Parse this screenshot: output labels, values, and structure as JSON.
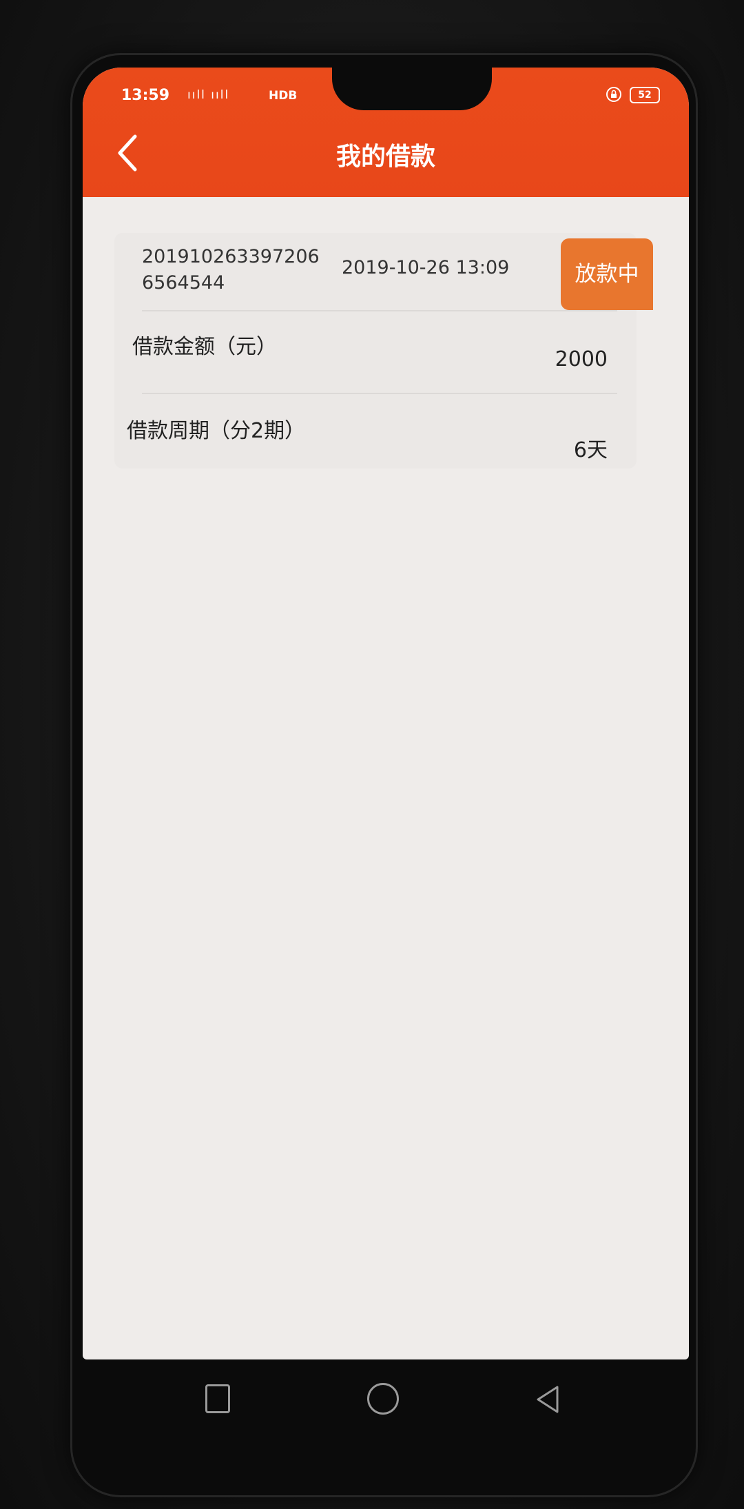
{
  "status_bar": {
    "time": "13:59",
    "signal": "ııll ııll",
    "network": "HDB",
    "battery": "52"
  },
  "header": {
    "title": "我的借款"
  },
  "loan": {
    "order_id": "2019102633972066564544",
    "datetime": "2019-10-26 13:09",
    "status": "放款中",
    "amount_label": "借款金额（元）",
    "amount_value": "2000",
    "period_label": "借款周期（分2期）",
    "period_value": "6天"
  },
  "colors": {
    "header": "#e8471a",
    "status_badge": "#e8762e",
    "screen_bg": "#efecea"
  },
  "icons": {
    "back": "chevron-left-icon",
    "lock": "lock-icon",
    "nav_recent": "square-icon",
    "nav_home": "circle-icon",
    "nav_back": "triangle-left-icon"
  }
}
